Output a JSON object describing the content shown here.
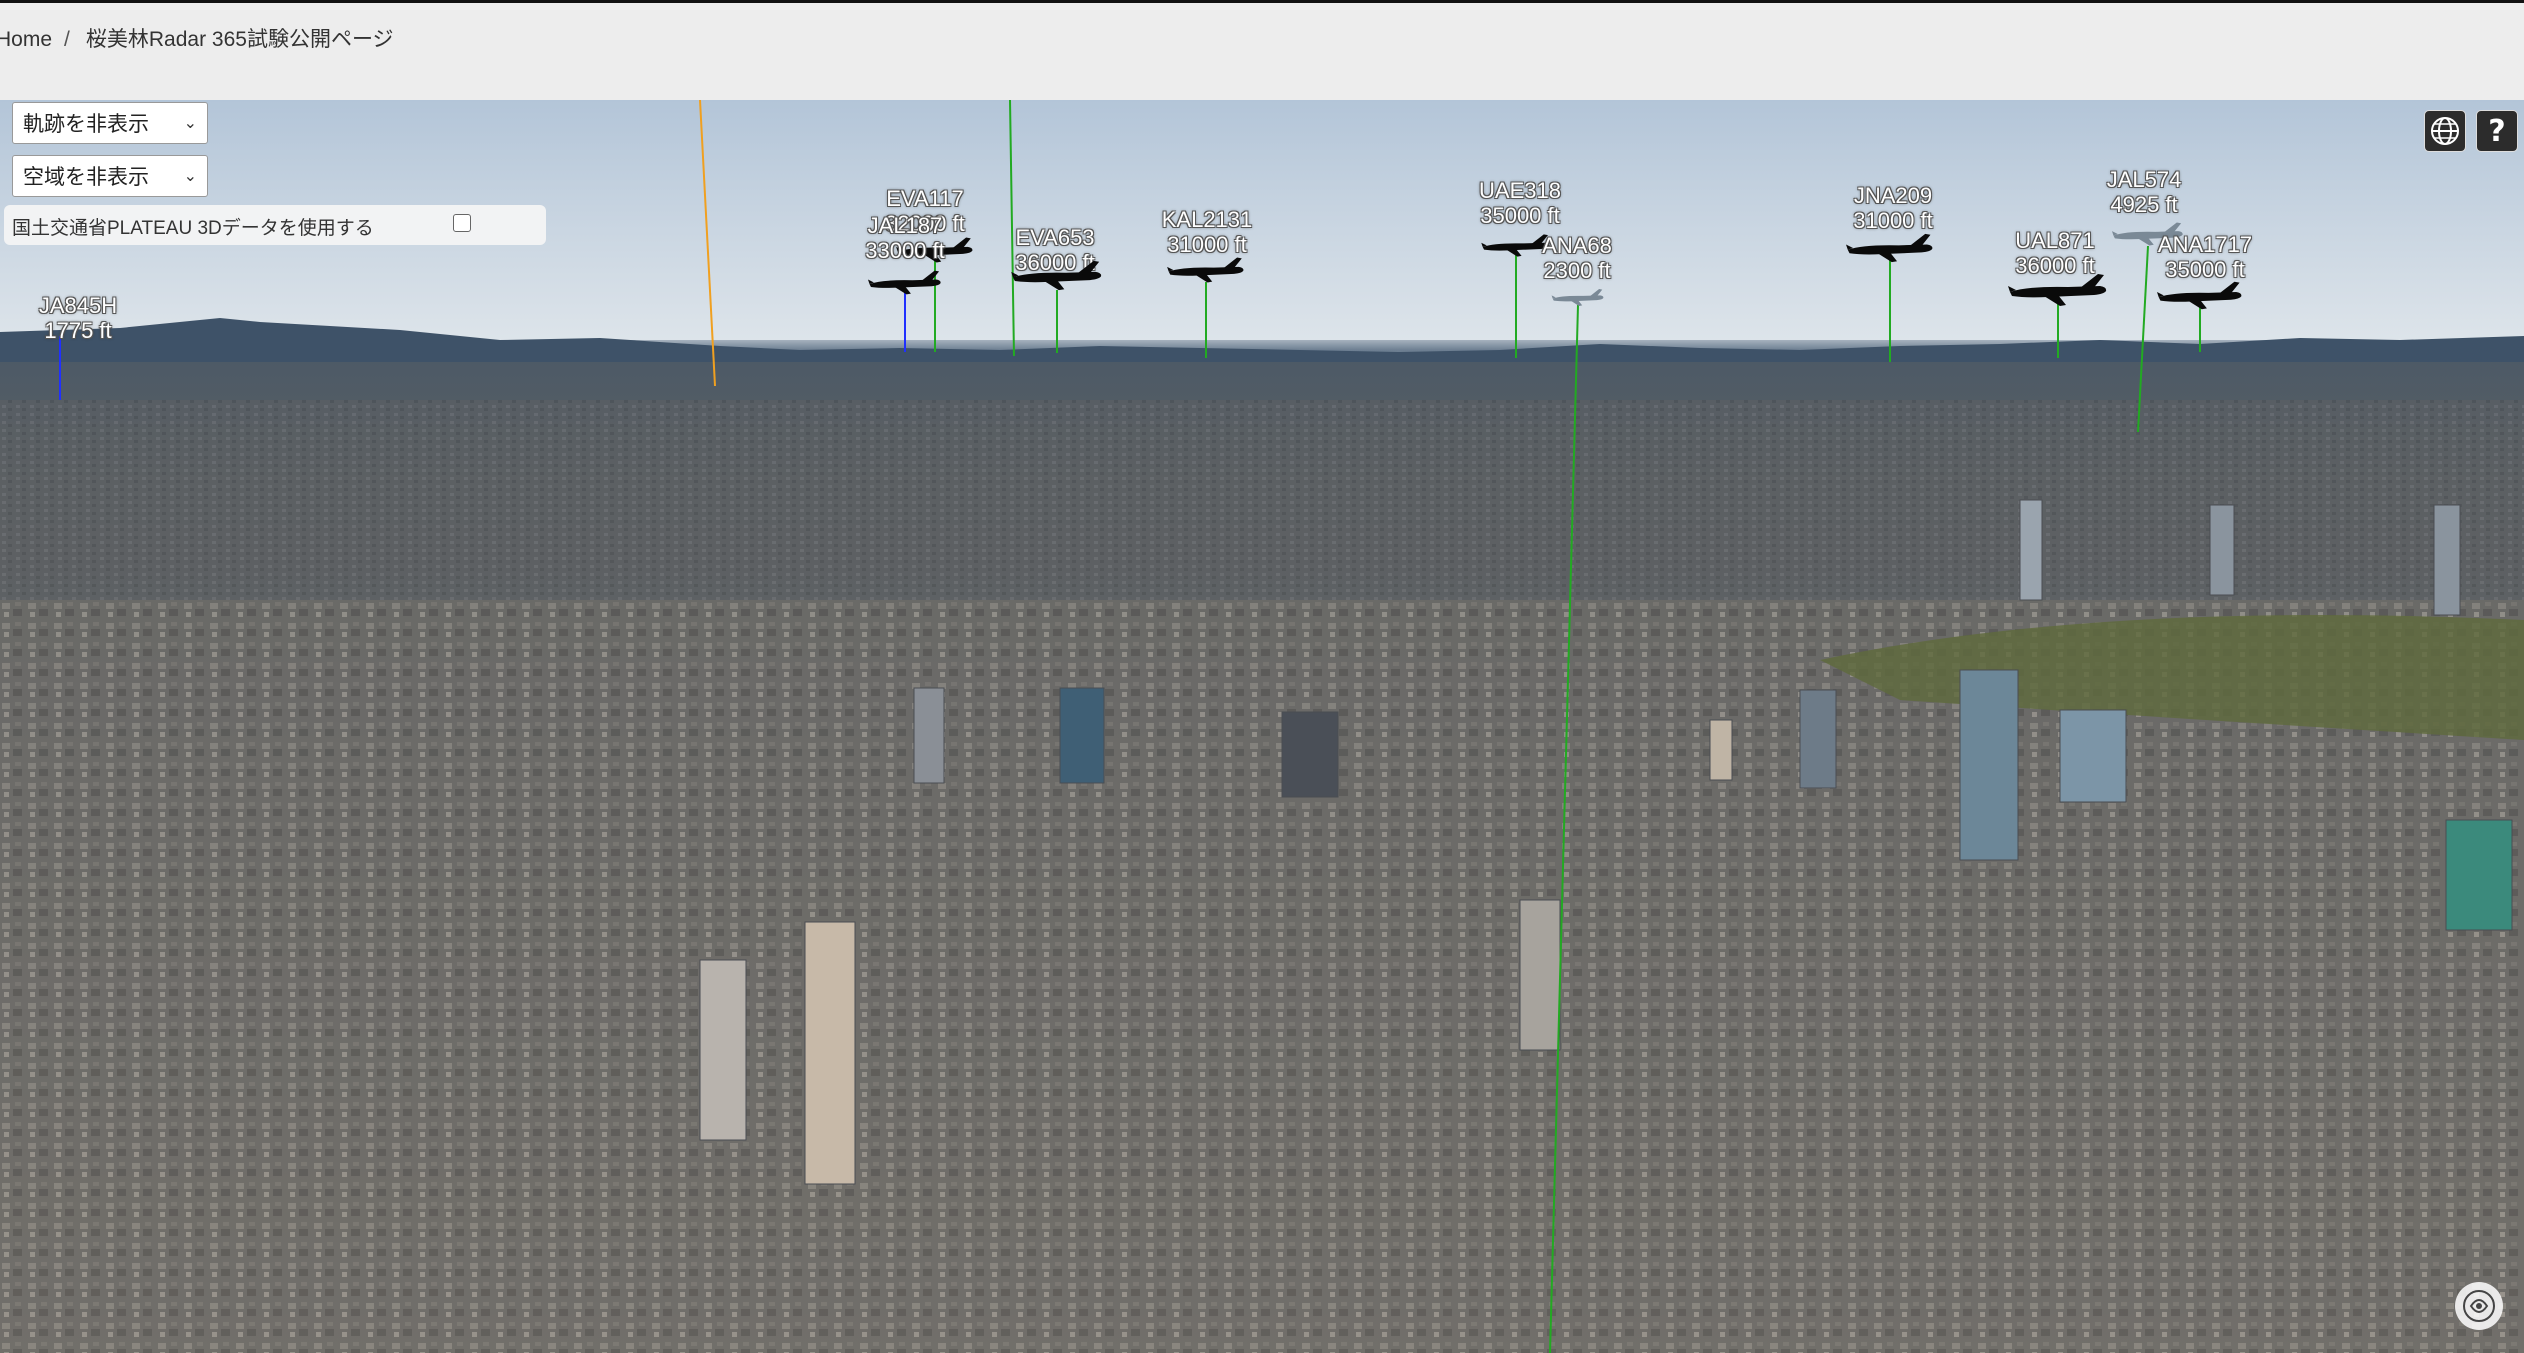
{
  "breadcrumb": {
    "home": "Home",
    "separator": "/",
    "current": "桜美林Radar 365試験公開ページ"
  },
  "controls": {
    "track_select": {
      "value": "軌跡を非表示"
    },
    "airspace_select": {
      "value": "空域を非表示"
    },
    "plateau": {
      "label": "国土交通省PLATEAU 3Dデータを使用する",
      "checked": false
    }
  },
  "toolbar": {
    "globe_icon": "globe-icon",
    "help_label": "?"
  },
  "aircraft": [
    {
      "callsign": "JA845H",
      "altitude": "1775 ft",
      "line_color": "#2030ff"
    },
    {
      "callsign": "EVA117",
      "altitude": "32000 ft",
      "line_color": "#22aa22"
    },
    {
      "callsign": "JAL187",
      "altitude": "33000 ft",
      "line_color": "#2030ff"
    },
    {
      "callsign": "EVA653",
      "altitude": "36000 ft",
      "line_color": "#22aa22"
    },
    {
      "callsign": "KAL2131",
      "altitude": "31000 ft",
      "line_color": "#22aa22"
    },
    {
      "callsign": "UAE318",
      "altitude": "35000 ft",
      "line_color": "#22aa22"
    },
    {
      "callsign": "ANA68",
      "altitude": "2300 ft",
      "line_color": "#22aa22"
    },
    {
      "callsign": "JNA209",
      "altitude": "31000 ft",
      "line_color": "#22aa22"
    },
    {
      "callsign": "UAL871",
      "altitude": "36000 ft",
      "line_color": "#22aa22"
    },
    {
      "callsign": "JAL574",
      "altitude": "4925 ft",
      "line_color": "#22aa22"
    },
    {
      "callsign": "ANA1717",
      "altitude": "35000 ft",
      "line_color": "#22aa22"
    }
  ],
  "colors": {
    "track_orange": "#f0a020",
    "track_green": "#22aa22"
  },
  "attribution_icon": "cesium-logo-icon"
}
